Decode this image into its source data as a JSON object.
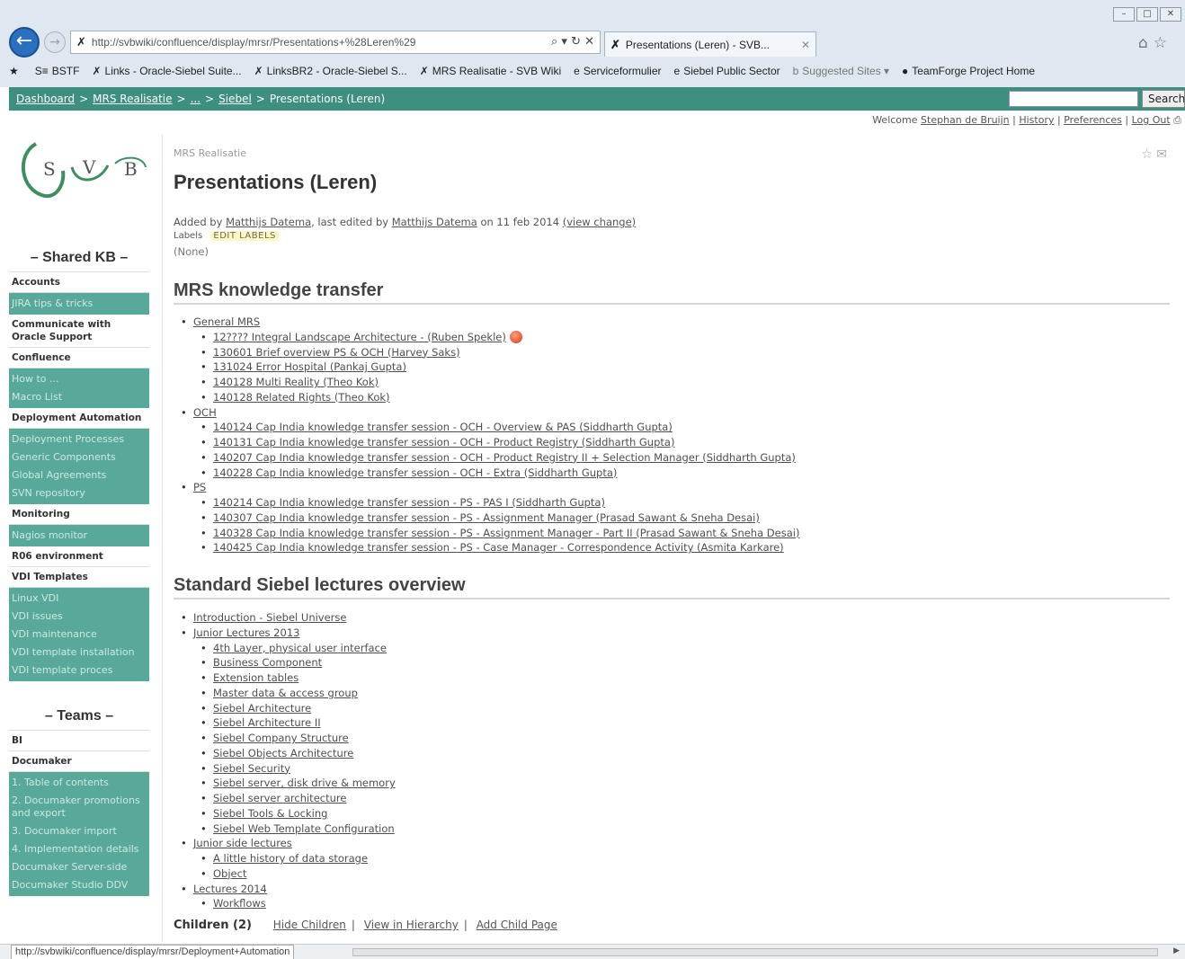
{
  "browser": {
    "address": "http://svbwiki/confluence/display/mrsr/Presentations+%28Leren%29",
    "address_tools": "⌕ ▾ ↻ ✕",
    "tab_title": "Presentations (Leren) - SVB...",
    "tab_close": "✕",
    "favorites": [
      {
        "label": "BSTF",
        "icon": "S≡"
      },
      {
        "label": "Links - Oracle-Siebel Suite...",
        "icon": "✗"
      },
      {
        "label": "LinksBR2 - Oracle-Siebel S...",
        "icon": "✗"
      },
      {
        "label": "MRS Realisatie - SVB Wiki",
        "icon": "✗"
      },
      {
        "label": "Serviceformulier",
        "icon": "e"
      },
      {
        "label": "Siebel Public Sector",
        "icon": "e"
      },
      {
        "label": "Suggested Sites ▾",
        "icon": "b",
        "gray": true
      },
      {
        "label": "TeamForge Project Home",
        "icon": "●"
      }
    ],
    "status_url": "http://svbwiki/confluence/display/mrsr/Deployment+Automation"
  },
  "nav": {
    "breadcrumbs": [
      "Dashboard",
      "MRS Realisatie",
      "...",
      "Siebel"
    ],
    "current": "Presentations (Leren)",
    "separator": ">",
    "search_label": "Search",
    "welcome": "Welcome",
    "user": "Stephan de Bruijn",
    "history": "History",
    "preferences": "Preferences",
    "logout": "Log Out"
  },
  "sidebar": {
    "shared_heading": "– Shared KB –",
    "teams_heading": "– Teams –",
    "shared_groups": [
      {
        "type": "cat",
        "label": "Accounts"
      },
      {
        "type": "links",
        "items": [
          "JIRA tips & tricks"
        ]
      },
      {
        "type": "cat",
        "label": "Communicate with Oracle Support"
      },
      {
        "type": "cat",
        "label": "Confluence"
      },
      {
        "type": "links",
        "items": [
          "How to ...",
          "Macro List"
        ]
      },
      {
        "type": "cat",
        "label": "Deployment Automation"
      },
      {
        "type": "links",
        "items": [
          "Deployment Processes",
          "Generic Components",
          "Global Agreements",
          "SVN repository"
        ]
      },
      {
        "type": "cat",
        "label": "Monitoring"
      },
      {
        "type": "links",
        "items": [
          "Nagios monitor"
        ]
      },
      {
        "type": "cat",
        "label": "R06 environment"
      },
      {
        "type": "cat",
        "label": "VDI Templates"
      },
      {
        "type": "links",
        "items": [
          "Linux VDI",
          "VDI issues",
          "VDI maintenance",
          "VDI template installation",
          "VDI template proces"
        ]
      }
    ],
    "team_groups": [
      {
        "type": "cat",
        "label": "BI"
      },
      {
        "type": "cat",
        "label": "Documaker"
      },
      {
        "type": "links",
        "items": [
          "1. Table of contents",
          "2. Documaker promotions and export",
          "3. Documaker import",
          "4. Implementation details",
          "Documaker Server-side",
          "Documaker Studio DDV"
        ]
      }
    ]
  },
  "page": {
    "space": "MRS Realisatie",
    "title": "Presentations (Leren)",
    "added_by_prefix": "Added by",
    "author": "Matthijs Datema",
    "edited_mid": ", last edited by",
    "editor": "Matthijs Datema",
    "date_text": "on 11 feb 2014",
    "view_change": "(view change)",
    "labels_label": "Labels",
    "edit_labels": "EDIT LABELS",
    "labels_value": "(None)",
    "page_icons": "☆ ✉"
  },
  "sections": [
    {
      "heading": "MRS knowledge transfer",
      "groups": [
        {
          "label": "General MRS",
          "items": [
            "12???? Integral Landscape Architecture - (Ruben Spekle)",
            "130601 Brief overview PS & OCH (Harvey Saks)",
            "131024 Error Hospital (Pankaj Gupta)",
            "140128 Multi Reality (Theo Kok)",
            "140128 Related Rights (Theo Kok)"
          ]
        },
        {
          "label": "OCH",
          "items": [
            "140124 Cap India knowledge transfer session - OCH - Overview & PAS (Siddharth Gupta)",
            "140131 Cap India knowledge transfer session - OCH - Product Registry (Siddharth Gupta)",
            "140207 Cap India knowledge transfer session - OCH - Product Registry II + Selection Manager (Siddharth Gupta)",
            "140228 Cap India knowledge transfer session - OCH - Extra (Siddharth Gupta)"
          ]
        },
        {
          "label": "PS",
          "items": [
            "140214 Cap India knowledge transfer session - PS - PAS I (Siddharth Gupta)",
            "140307 Cap India knowledge transfer session - PS - Assignment Manager (Prasad Sawant & Sneha Desai)",
            "140328 Cap India knowledge transfer session - PS - Assignment Manager - Part II (Prasad Sawant & Sneha Desai)",
            "140425 Cap India knowledge transfer session - PS - Case Manager - Correspondence Activity (Asmita Karkare)"
          ]
        }
      ]
    },
    {
      "heading": "Standard Siebel lectures overview",
      "groups": [
        {
          "label": "Introduction - Siebel Universe",
          "items": []
        },
        {
          "label": "Junior Lectures 2013",
          "items": [
            "4th Layer, physical user interface",
            "Business Component",
            "Extension tables",
            "Master data & access group",
            "Siebel Architecture",
            "Siebel Architecture II",
            "Siebel Company Structure",
            "Siebel Objects Architecture",
            "Siebel Security",
            "Siebel server, disk drive & memory",
            "Siebel server architecture",
            "Siebel Tools & Locking",
            "Siebel Web Template Configuration"
          ]
        },
        {
          "label": "Junior side lectures",
          "items": [
            "A little history of data storage",
            "Object"
          ]
        },
        {
          "label": "Lectures 2014",
          "items": [
            "Workflows"
          ]
        }
      ]
    }
  ],
  "children": {
    "label": "Children (2)",
    "hide": "Hide Children",
    "hierarchy": "View in Hierarchy",
    "add": "Add Child Page"
  },
  "colors": {
    "nav_bar": "#3d8f80",
    "sidebar_links_bg": "#58a999"
  }
}
